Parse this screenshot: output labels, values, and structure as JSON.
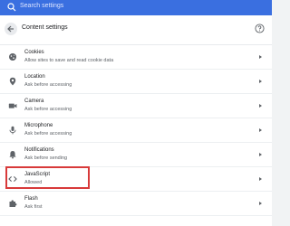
{
  "search": {
    "placeholder": "Search settings"
  },
  "header": {
    "title": "Content settings"
  },
  "rows": [
    {
      "title": "Cookies",
      "subtitle": "Allow sites to save and read cookie data",
      "icon": "cookie-icon"
    },
    {
      "title": "Location",
      "subtitle": "Ask before accessing",
      "icon": "location-pin-icon"
    },
    {
      "title": "Camera",
      "subtitle": "Ask before accessing",
      "icon": "camera-icon"
    },
    {
      "title": "Microphone",
      "subtitle": "Ask before accessing",
      "icon": "microphone-icon"
    },
    {
      "title": "Notifications",
      "subtitle": "Ask before sending",
      "icon": "bell-icon"
    },
    {
      "title": "JavaScript",
      "subtitle": "Allowed",
      "icon": "code-icon"
    },
    {
      "title": "Flash",
      "subtitle": "Ask first",
      "icon": "puzzle-icon"
    }
  ],
  "colors": {
    "topbar": "#3a6fe0",
    "highlight": "#d83a3a"
  }
}
